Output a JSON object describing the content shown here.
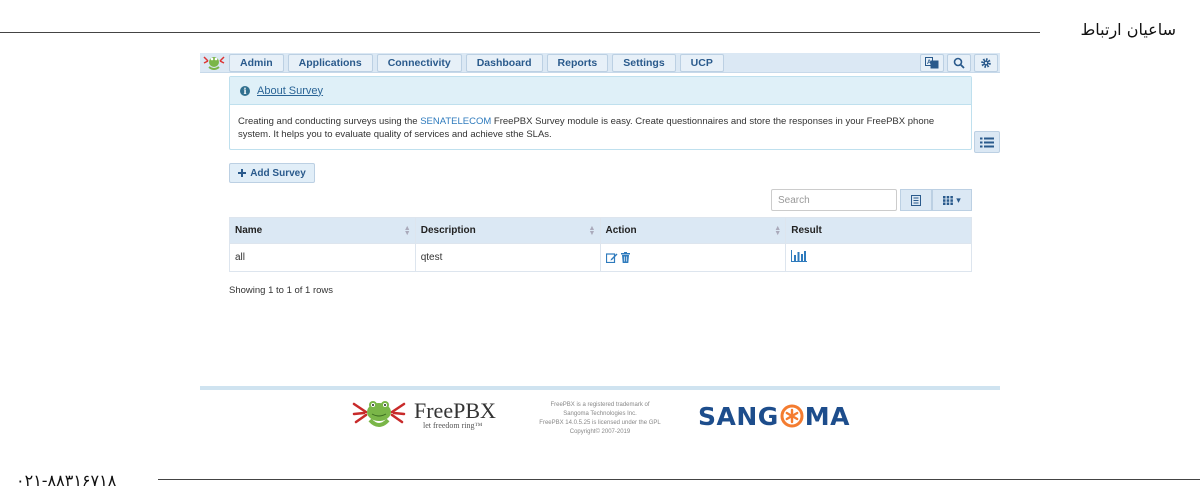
{
  "frame": {
    "brand_text": "ساعیان ارتباط",
    "phone": "۰۲۱-۸۸۳۱۶۷۱۸"
  },
  "navbar": {
    "logo": "freepbx-frog-icon",
    "menu": [
      "Admin",
      "Applications",
      "Connectivity",
      "Dashboard",
      "Reports",
      "Settings",
      "UCP"
    ],
    "icons": [
      "language-icon",
      "search-icon",
      "gear-icon"
    ]
  },
  "about": {
    "title": "About Survey",
    "body_before": "Creating and conducting surveys using the ",
    "body_link": "SENATELECOM",
    "body_after": " FreePBX Survey module is easy. Create questionnaires and store the responses in your FreePBX phone system. It helps you to evaluate quality of services and achieve sthe SLAs."
  },
  "add_button": "Add Survey",
  "toolbar": {
    "search_placeholder": "Search"
  },
  "table": {
    "columns": [
      "Name",
      "Description",
      "Action",
      "Result"
    ],
    "rows": [
      {
        "name": "all",
        "description": "qtest"
      }
    ]
  },
  "pagination_text": "Showing 1 to 1 of 1 rows",
  "footer": {
    "freepbx_name": "FreePBX",
    "freepbx_tagline": "let freedom ring™",
    "legal": [
      "FreePBX is a registered trademark of",
      "Sangoma Technologies Inc.",
      "FreePBX 14.0.5.25 is licensed under the GPL",
      "Copyright© 2007-2019"
    ],
    "sangoma_left": "SANG",
    "sangoma_right": "MA"
  },
  "colors": {
    "accent": "#2a5a8c",
    "nav_bg": "#dbe8f4",
    "info_bg": "#dff0f8",
    "sangoma_blue": "#1d4d8c",
    "sangoma_orange": "#f47c30"
  }
}
